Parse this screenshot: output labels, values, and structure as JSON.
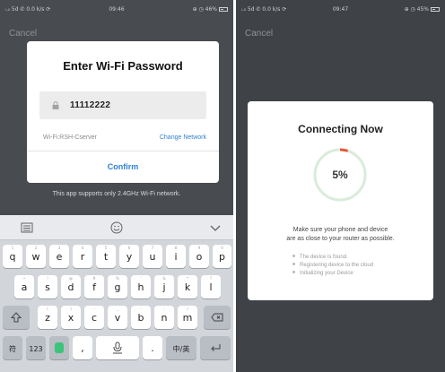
{
  "left": {
    "status": {
      "carrier": "ᵢ.ₗₗ 5d ✆ 0.0 k/s ⟳",
      "time": "09:46",
      "battery": "⊕ ◷ 46%"
    },
    "cancel_label": "Cancel",
    "dialog": {
      "title": "Enter Wi-Fi Password",
      "password_value": "11112222",
      "wifi_label": "Wi-Fi:RSH-Cserver",
      "change_network_label": "Change Network",
      "confirm_label": "Confirm"
    },
    "support_note": "This app supports only 2.4GHz Wi-Fi network.",
    "keyboard": {
      "row1": [
        "q",
        "w",
        "e",
        "r",
        "t",
        "y",
        "u",
        "i",
        "o",
        "p"
      ],
      "row1_sub": [
        "1",
        "2",
        "3",
        "4",
        "5",
        "6",
        "7",
        "8",
        "9",
        "0"
      ],
      "row2": [
        "a",
        "s",
        "d",
        "f",
        "g",
        "h",
        "j",
        "k",
        "l"
      ],
      "row2_sub": [
        "~",
        "!",
        "@",
        "#",
        "%",
        "'",
        "&",
        "*",
        "?"
      ],
      "row3": [
        "z",
        "x",
        "c",
        "v",
        "b",
        "n",
        "m"
      ],
      "row3_sub": [
        "(",
        ")",
        "-",
        "_",
        ":",
        ";",
        "/"
      ],
      "sym_label": "符",
      "num_label": "123",
      "comma_label": ",",
      "period_label": ".",
      "lang_label": "中/英"
    }
  },
  "right": {
    "status": {
      "carrier": "ᵢ.ₗₗ 5d ✆ 0.0 k/s ⟳",
      "time": "09:47",
      "battery": "⊕ ◷ 45%"
    },
    "cancel_label": "Cancel",
    "card": {
      "title": "Connecting Now",
      "progress_label": "5%",
      "progress": 0.05,
      "tip_line1": "Make sure your phone and device",
      "tip_line2": "are as close to your router as possible.",
      "steps": [
        "The device is found.",
        "Registering device to the cloud",
        "Initializing your Device"
      ]
    }
  },
  "colors": {
    "accent_blue": "#2f7fd6",
    "progress_orange": "#e8553a",
    "ring_green": "#d9ecd9",
    "overlay_dark": "#484b4f"
  }
}
